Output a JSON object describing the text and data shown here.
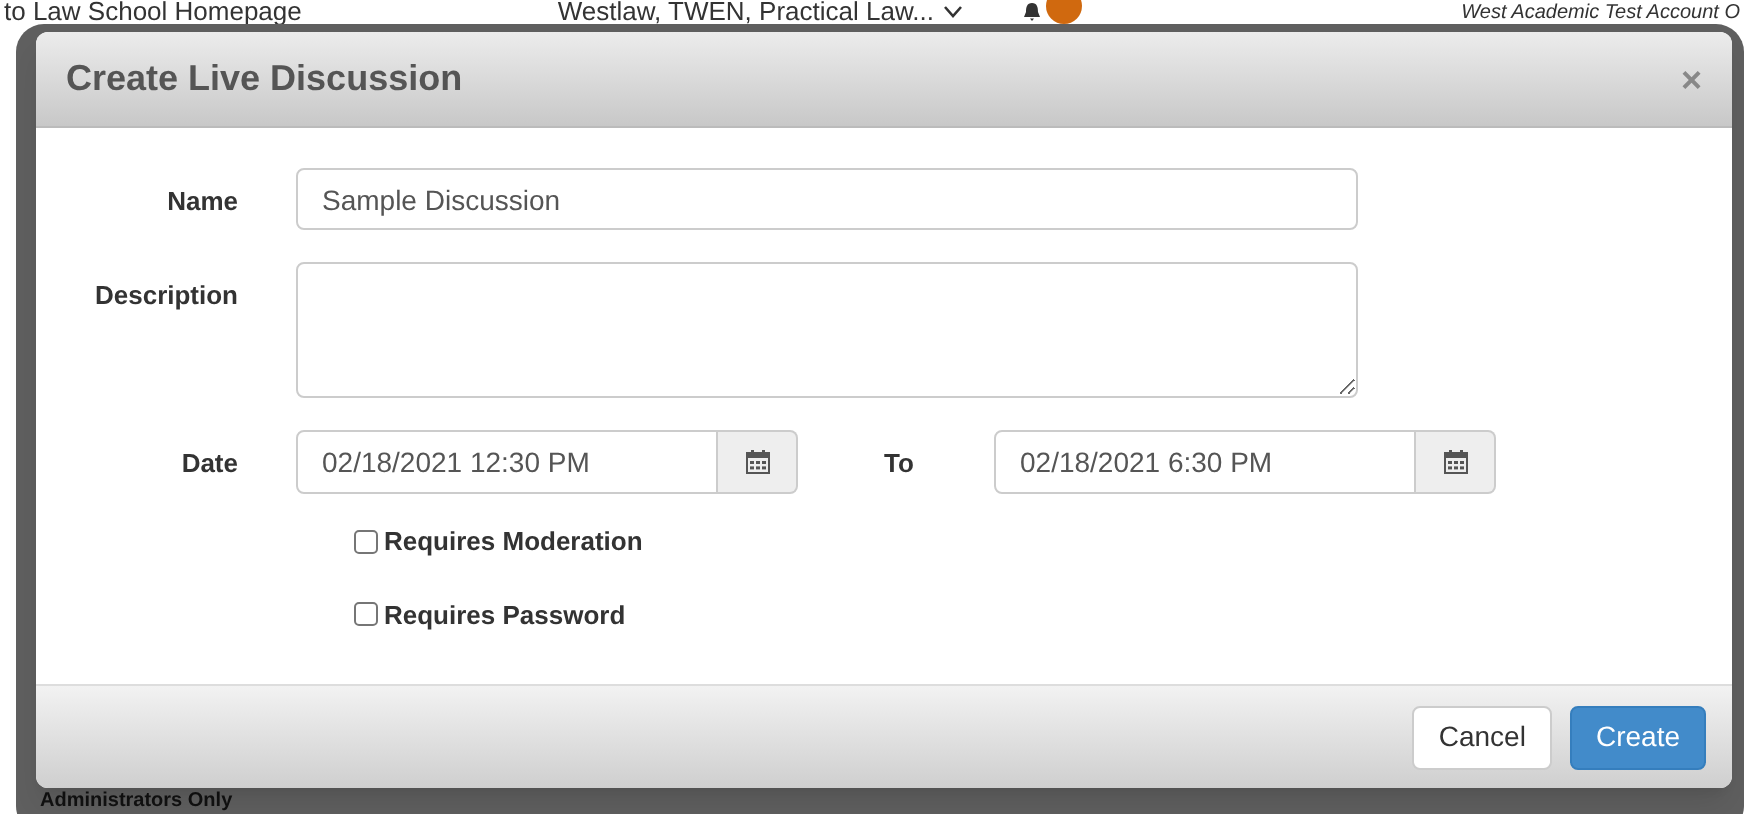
{
  "background_page": {
    "header_link": "to Law School Homepage",
    "product_menu": "Westlaw, TWEN, Practical Law...",
    "account": "West Academic Test Account O",
    "footer_text": "Administrators Only"
  },
  "dialog": {
    "title": "Create Live Discussion",
    "close": "×",
    "fields": [
      {
        "kind": "text",
        "label": "Name",
        "value": "Sample Discussion"
      },
      {
        "kind": "textarea",
        "label": "Description"
      },
      {
        "kind": "daterange",
        "label": "Date",
        "value": "02/18/2021 12:30 PM",
        "to_label": "To",
        "to_value": "02/18/2021 6:30 PM"
      }
    ],
    "options": [
      {
        "label": "Requires Moderation",
        "checked": false
      },
      {
        "label": "Requires Password",
        "checked": false
      }
    ],
    "buttons": [
      {
        "label": "Cancel",
        "kind": "default"
      },
      {
        "label": "Create",
        "kind": "primary"
      }
    ]
  }
}
